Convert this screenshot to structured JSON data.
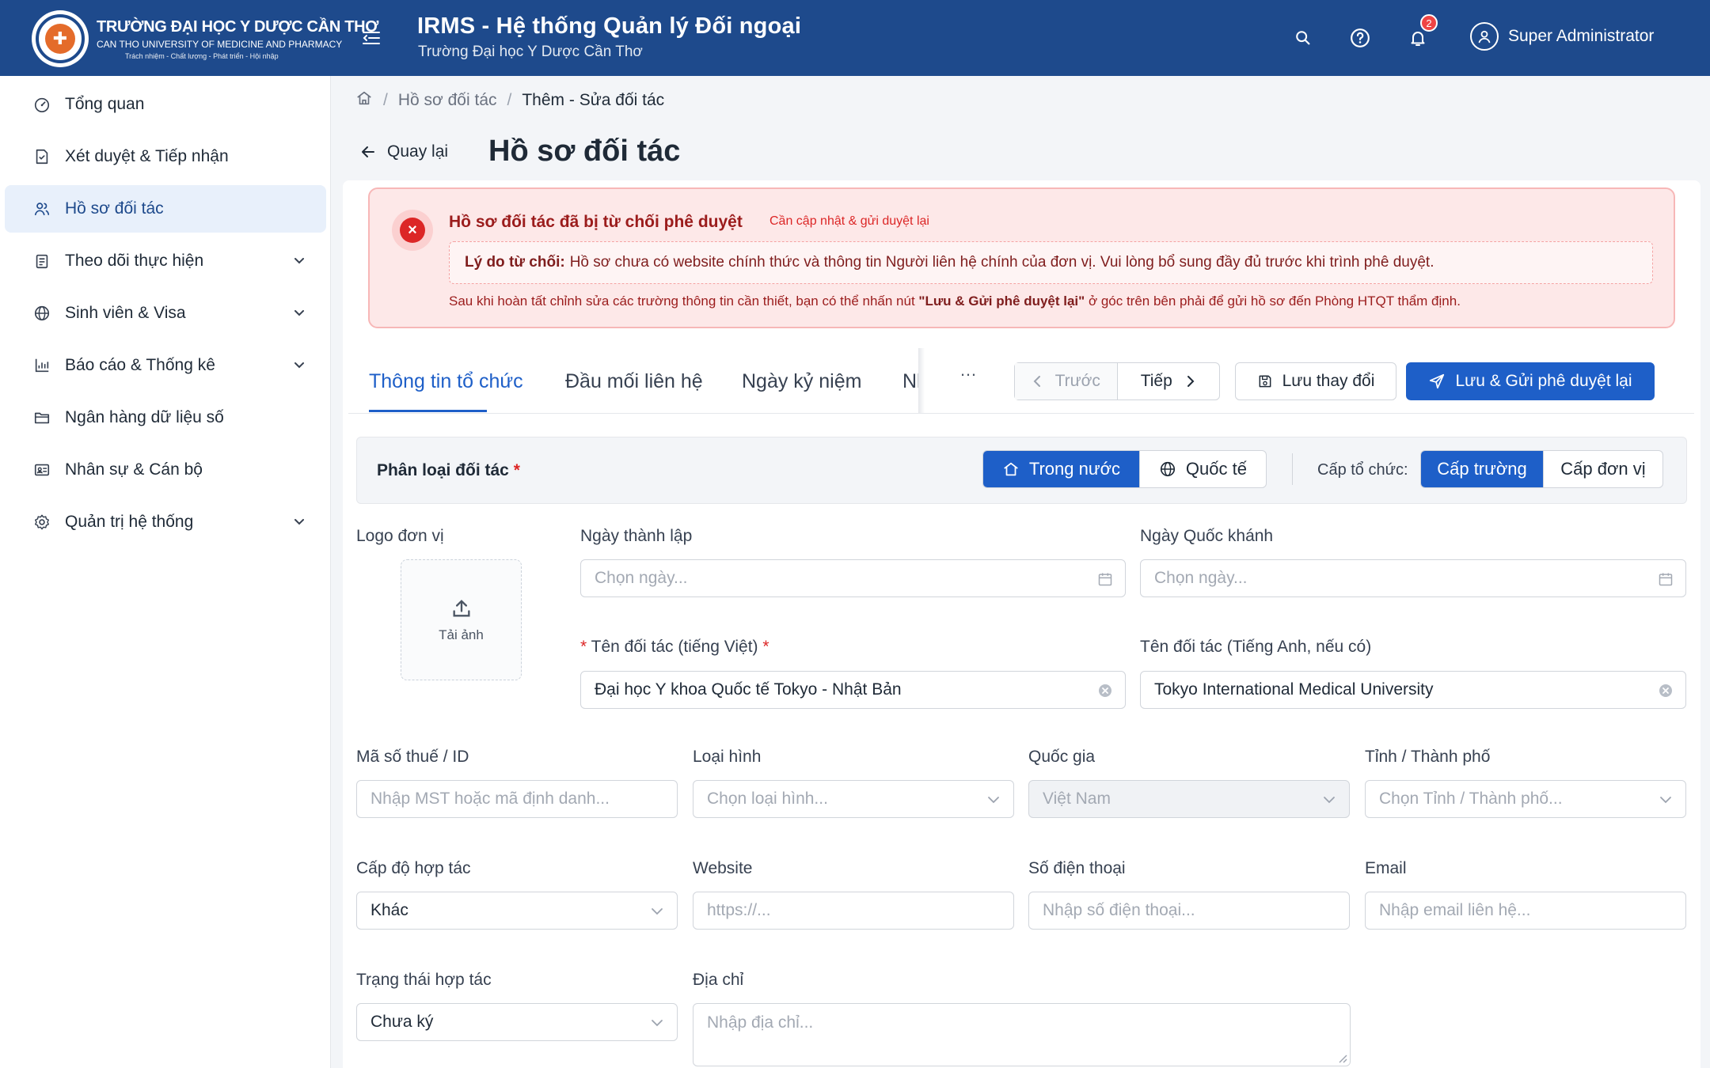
{
  "header": {
    "brand_name": "TRƯỜNG ĐẠI HỌC Y DƯỢC CẦN THƠ",
    "brand_en": "CAN THO UNIVERSITY OF MEDICINE AND PHARMACY",
    "brand_motto": "Trách nhiệm - Chất lượng - Phát triển - Hội nhập",
    "app_title": "IRMS - Hệ thống Quản lý Đối ngoại",
    "app_subtitle": "Trường Đại học Y Dược Cần Thơ",
    "notification_count": "2",
    "user_name": "Super Administrator"
  },
  "sidebar": {
    "items": [
      {
        "label": "Tổng quan",
        "icon": "dashboard-icon",
        "expandable": false
      },
      {
        "label": "Xét duyệt & Tiếp nhận",
        "icon": "document-check-icon",
        "expandable": false
      },
      {
        "label": "Hồ sơ đối tác",
        "icon": "users-icon",
        "expandable": false,
        "active": true
      },
      {
        "label": "Theo dõi thực hiện",
        "icon": "clipboard-icon",
        "expandable": true
      },
      {
        "label": "Sinh viên & Visa",
        "icon": "globe-icon",
        "expandable": true
      },
      {
        "label": "Báo cáo & Thống kê",
        "icon": "bar-chart-icon",
        "expandable": true
      },
      {
        "label": "Ngân hàng dữ liệu số",
        "icon": "folder-icon",
        "expandable": false
      },
      {
        "label": "Nhân sự & Cán bộ",
        "icon": "id-card-icon",
        "expandable": false
      },
      {
        "label": "Quản trị hệ thống",
        "icon": "gear-icon",
        "expandable": true
      }
    ]
  },
  "breadcrumb": {
    "items": [
      "Hồ sơ đối tác",
      "Thêm - Sửa đối tác"
    ]
  },
  "page": {
    "back_label": "Quay lại",
    "title": "Hồ sơ đối tác"
  },
  "alert": {
    "title": "Hồ sơ đối tác đã bị từ chối phê duyệt",
    "tag": "Cần cập nhật & gửi duyệt lại",
    "reason_label": "Lý do từ chối:",
    "reason_text": "Hồ sơ chưa có website chính thức và thông tin Người liên hệ chính của đơn vị. Vui lòng bổ sung đầy đủ trước khi trình phê duyệt.",
    "note_before": "Sau khi hoàn tất chỉnh sửa các trường thông tin cần thiết, bạn có thể nhấn nút ",
    "note_strong": "\"Lưu & Gửi phê duyệt lại\"",
    "note_after": " ở góc trên bên phải để gửi hồ sơ đến Phòng HTQT thẩm định."
  },
  "tabs": {
    "items": [
      "Thông tin tổ chức",
      "Đầu mối liên hệ",
      "Ngày kỷ niệm",
      "Nh"
    ],
    "more": "…"
  },
  "toolbar": {
    "prev_label": "Trước",
    "next_label": "Tiếp",
    "save_label": "Lưu thay đổi",
    "submit_label": "Lưu & Gửi phê duyệt lại"
  },
  "partner_type": {
    "label": "Phân loại đối tác",
    "options": [
      "Trong nước",
      "Quốc tế"
    ],
    "selected": "Trong nước",
    "level_label": "Cấp tổ chức:",
    "level_options": [
      "Cấp trường",
      "Cấp đơn vị"
    ],
    "level_selected": "Cấp trường"
  },
  "form": {
    "logo_label": "Logo đơn vị",
    "upload_label": "Tải ảnh",
    "founded_label": "Ngày thành lập",
    "founded_placeholder": "Chọn ngày...",
    "national_day_label": "Ngày Quốc khánh",
    "national_day_placeholder": "Chọn ngày...",
    "name_vi_label": "Tên đối tác (tiếng Việt)",
    "name_vi_value": "Đại học Y khoa Quốc tế Tokyo - Nhật Bản",
    "name_en_label": "Tên đối tác (Tiếng Anh, nếu có)",
    "name_en_value": "Tokyo International Medical University",
    "tax_label": "Mã số thuế / ID",
    "tax_placeholder": "Nhập MST hoặc mã định danh...",
    "type_label": "Loại hình",
    "type_placeholder": "Chọn loại hình...",
    "country_label": "Quốc gia",
    "country_value": "Việt Nam",
    "province_label": "Tỉnh / Thành phố",
    "province_placeholder": "Chọn Tỉnh / Thành phố...",
    "coop_level_label": "Cấp độ hợp tác",
    "coop_level_value": "Khác",
    "website_label": "Website",
    "website_placeholder": "https://...",
    "phone_label": "Số điện thoại",
    "phone_placeholder": "Nhập số điện thoại...",
    "email_label": "Email",
    "email_placeholder": "Nhập email liên hệ...",
    "status_label": "Trạng thái hợp tác",
    "status_value": "Chưa ký",
    "address_label": "Địa chỉ",
    "address_placeholder": "Nhập địa chỉ..."
  },
  "colors": {
    "header_bg": "#1e4a8c",
    "primary": "#1e5fc8",
    "danger": "#dc2626",
    "alert_bg": "#fde8e8",
    "active_nav_bg": "#e8f0fb"
  }
}
